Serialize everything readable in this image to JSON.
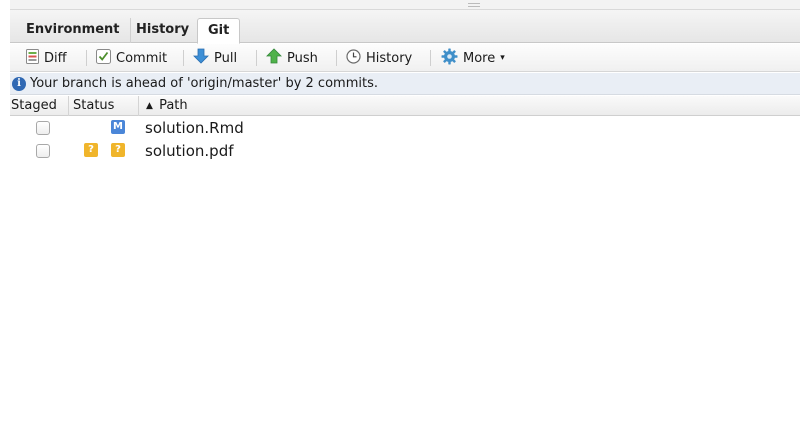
{
  "tabs": [
    {
      "label": "Environment",
      "active": false
    },
    {
      "label": "History",
      "active": false
    },
    {
      "label": "Git",
      "active": true
    }
  ],
  "toolbar": {
    "diff_label": "Diff",
    "commit_label": "Commit",
    "pull_label": "Pull",
    "push_label": "Push",
    "history_label": "History",
    "more_label": "More"
  },
  "info": {
    "message": "Your branch is ahead of 'origin/master' by 2 commits.",
    "icon": "info-icon"
  },
  "table": {
    "columns": {
      "staged": "Staged",
      "status": "Status",
      "path": "Path"
    },
    "sort_indicator": "▲",
    "rows": [
      {
        "staged": false,
        "status": [
          "M"
        ],
        "path": "solution.Rmd"
      },
      {
        "staged": false,
        "status": [
          "?",
          "?"
        ],
        "path": "solution.pdf"
      }
    ]
  },
  "colors": {
    "modified_badge": "#4a86d8",
    "untracked_badge": "#f0b52b",
    "info_icon": "#2f68b3"
  }
}
